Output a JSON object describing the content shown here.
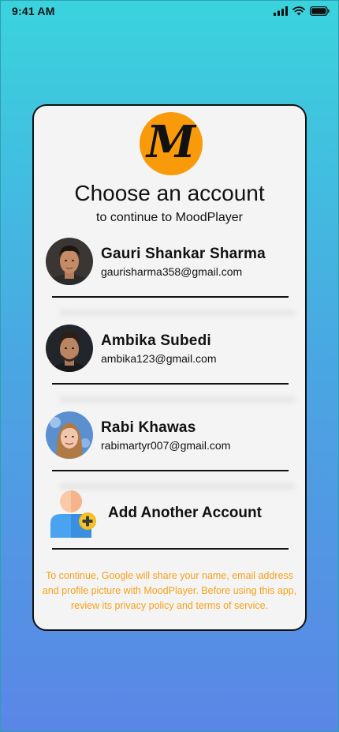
{
  "status_bar": {
    "time": "9:41 AM",
    "icons": [
      "signal-icon",
      "wifi-icon",
      "battery-icon"
    ]
  },
  "card": {
    "logo_letter": "M",
    "title": "Choose an account",
    "subtitle": "to continue to MoodPlayer",
    "accounts": [
      {
        "name": "Gauri Shankar Sharma",
        "email": "gaurisharma358@gmail.com"
      },
      {
        "name": "Ambika Subedi",
        "email": "ambika123@gmail.com"
      },
      {
        "name": "Rabi Khawas",
        "email": "rabimartyr007@gmail.com"
      }
    ],
    "add_account_label": "Add Another Account",
    "disclaimer": "To continue, Google will share your name, email address and profile picture with MoodPlayer. Before using this app, review its privacy policy and terms of service."
  },
  "colors": {
    "gradient_top": "#3ad3dd",
    "gradient_bottom": "#5a86e6",
    "logo_bg": "#f99a0a",
    "disclaimer_text": "#f5a11a",
    "card_bg": "#f4f4f4"
  }
}
